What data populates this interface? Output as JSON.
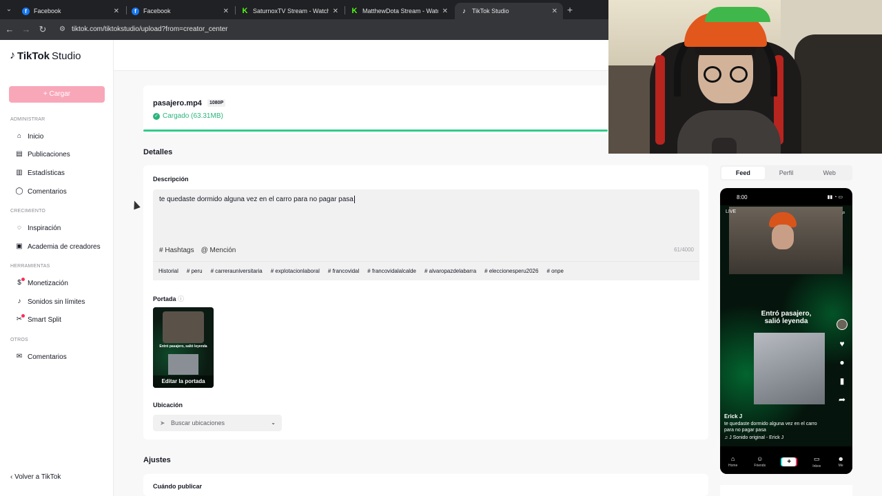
{
  "browser": {
    "tabs": [
      {
        "title": "Facebook",
        "icon": "facebook-icon"
      },
      {
        "title": "Facebook",
        "icon": "facebook-icon"
      },
      {
        "title": "SaturnoxTV Stream - Watch Live",
        "icon": "kick-icon"
      },
      {
        "title": "MatthewDota Stream - Watch Live",
        "icon": "kick-icon"
      },
      {
        "title": "TikTok Studio",
        "icon": "tiktok-icon"
      }
    ],
    "url": "tiktok.com/tiktokstudio/upload?from=creator_center"
  },
  "sidebar": {
    "brand": "TikTok",
    "studio": "Studio",
    "upload_label": "Cargar",
    "sections": {
      "admin": "ADMINISTRAR",
      "growth": "CRECIMIENTO",
      "tools": "HERRAMIENTAS",
      "others": "OTROS"
    },
    "items": {
      "home": "Inicio",
      "posts": "Publicaciones",
      "stats": "Estadísticas",
      "comments": "Comentarios",
      "inspiration": "Inspiración",
      "academy": "Academia de creadores",
      "monetization": "Monetización",
      "sounds": "Sonidos sin límites",
      "smart_split": "Smart Split",
      "comments_other": "Comentarios"
    },
    "back_label": "Volver a TikTok"
  },
  "upload": {
    "file_name": "pasajero.mp4",
    "resolution": "1080P",
    "status": "Cargado",
    "size": "(63.31MB)",
    "progress": 1.0
  },
  "details": {
    "section_title": "Detalles",
    "description_label": "Descripción",
    "description_text": "te quedaste dormido alguna vez en el carro para no pagar pasa",
    "hashtags_btn": "Hashtags",
    "mention_btn": "Mención",
    "char_count": "61/4000",
    "history_label": "Historial",
    "suggested_hashtags": [
      "# peru",
      "# carrerauniversitaria",
      "# explotacionlaboral",
      "# francovidal",
      "# francovidalalcalde",
      "# alvaropazdelabarra",
      "# eleccionesperu2026",
      "# onpe"
    ],
    "cover_label": "Portada",
    "cover_edit": "Editar la portada",
    "cover_caption": "Entró pasajero, salió leyenda",
    "location_label": "Ubicación",
    "location_placeholder": "Buscar ubicaciones"
  },
  "settings": {
    "section_title": "Ajustes",
    "schedule_label": "Cuándo publicar"
  },
  "preview": {
    "tabs": [
      "Feed",
      "Perfil",
      "Web"
    ],
    "active_tab": "Feed",
    "time": "8:00",
    "caption_line1": "Entró pasajero,",
    "caption_line2": "salió leyenda",
    "author": "Erick J",
    "description": "te quedaste dormido alguna vez en el carro para no pagar pasa",
    "sound": "♫ J  Sonido original - Erick J",
    "nav": [
      "Home",
      "Friends",
      "",
      "Inbox",
      "Me"
    ]
  },
  "colors": {
    "accent": "#fe2c55",
    "upload_btn": "#f8a7b9",
    "success": "#2ab47a"
  }
}
